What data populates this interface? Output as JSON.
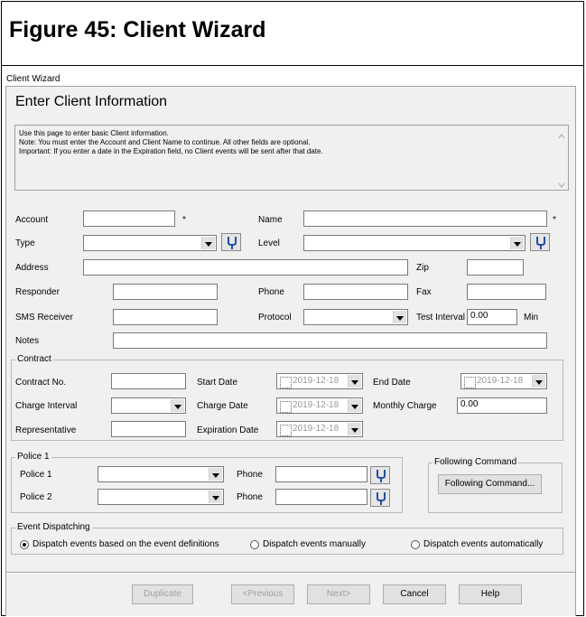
{
  "figure": {
    "title": "Figure 45:  Client Wizard"
  },
  "window": {
    "label": "Client Wizard"
  },
  "dialog": {
    "title": "Enter Client Information",
    "info_lines": [
      "Use this page to enter basic Client information.",
      "Note: You must enter the Account and Client Name to continue. All other fields are optional.",
      "Important: If you enter a date in the Expiration field, no Client events will be sent after that date."
    ]
  },
  "fields": {
    "account_label": "Account",
    "account_value": "",
    "required_mark": "*",
    "name_label": "Name",
    "name_value": "",
    "type_label": "Type",
    "type_value": "",
    "level_label": "Level",
    "level_value": "",
    "address_label": "Address",
    "address_value": "",
    "zip_label": "Zip",
    "zip_value": "",
    "responder_label": "Responder",
    "responder_value": "",
    "phone_label": "Phone",
    "phone_value": "",
    "fax_label": "Fax",
    "fax_value": "",
    "sms_label": "SMS Receiver",
    "sms_value": "",
    "protocol_label": "Protocol",
    "protocol_value": "",
    "test_interval_label": "Test Interval",
    "test_interval_value": "0.00",
    "test_interval_unit": "Min",
    "notes_label": "Notes",
    "notes_value": ""
  },
  "contract": {
    "group_title": "Contract",
    "contract_no_label": "Contract No.",
    "contract_no_value": "",
    "start_date_label": "Start Date",
    "start_date_value": "2019-12-18",
    "end_date_label": "End Date",
    "end_date_value": "2019-12-18",
    "charge_interval_label": "Charge Interval",
    "charge_interval_value": "",
    "charge_date_label": "Charge Date",
    "charge_date_value": "2019-12-18",
    "monthly_charge_label": "Monthly Charge",
    "monthly_charge_value": "0.00",
    "representative_label": "Representative",
    "representative_value": "",
    "expiration_date_label": "Expiration Date",
    "expiration_date_value": "2019-12-18"
  },
  "police": {
    "group_title": "Police 1",
    "police1_label": "Police 1",
    "police1_value": "",
    "police2_label": "Police 2",
    "police2_value": "",
    "phone_label": "Phone",
    "phone1_value": "",
    "phone2_value": ""
  },
  "following": {
    "group_title": "Following Command",
    "button_label": "Following Command..."
  },
  "dispatch": {
    "group_title": "Event Dispatching",
    "options": [
      "Dispatch events based on the event definitions",
      "Dispatch events manually",
      "Dispatch events automatically"
    ],
    "selected_index": 0
  },
  "buttons": {
    "duplicate": "Duplicate",
    "previous": "<Previous",
    "next": "Next>",
    "cancel": "Cancel",
    "help": "Help"
  },
  "icons": {
    "picker": "tuning-fork-icon",
    "scroll_up": "chevron-up-icon",
    "scroll_down": "chevron-down-icon",
    "dropdown": "dropdown-arrow-icon"
  },
  "colors": {
    "dialog_bg": "#f0f0f0",
    "picker_icon": "#1f4fa8"
  }
}
